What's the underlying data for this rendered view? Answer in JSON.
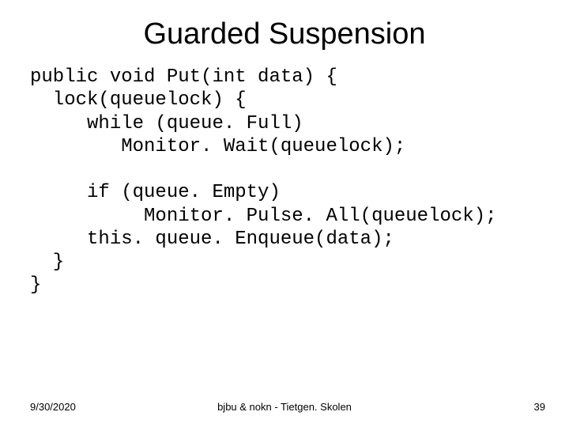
{
  "title": "Guarded Suspension",
  "code": {
    "l1": "public void Put(int data) {",
    "l2": "  lock(queuelock) {",
    "l3": "     while (queue. Full)",
    "l4": "        Monitor. Wait(queuelock);",
    "l5": "",
    "l6": "     if (queue. Empty)",
    "l7": "          Monitor. Pulse. All(queuelock);",
    "l8": "     this. queue. Enqueue(data);",
    "l9": "  }",
    "l10": "}"
  },
  "footer": {
    "date": "9/30/2020",
    "center": "bjbu & nokn - Tietgen. Skolen",
    "page": "39"
  }
}
